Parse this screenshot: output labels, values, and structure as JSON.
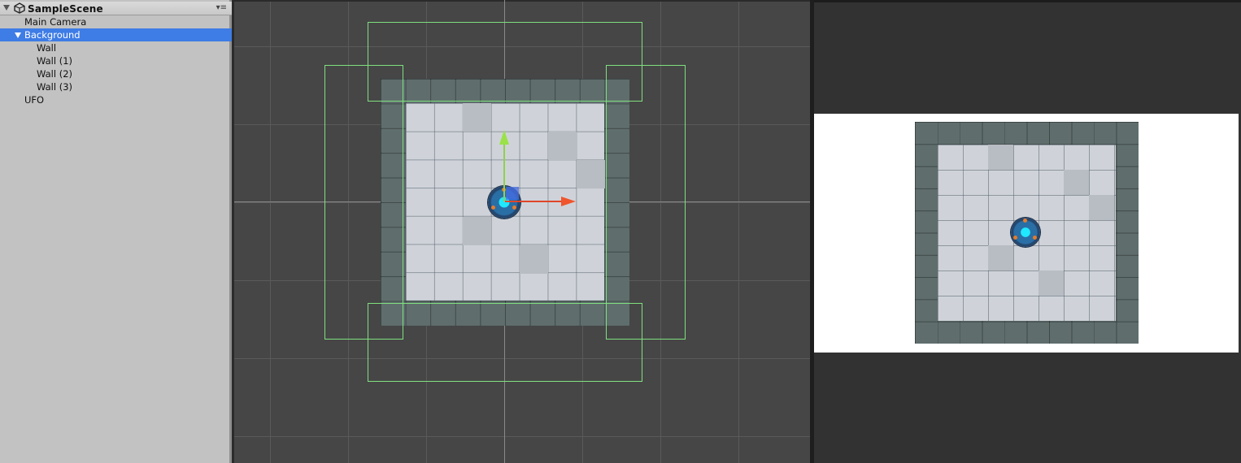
{
  "hierarchy": {
    "scene_name": "SampleScene",
    "menu_icon": "▾≡",
    "items": [
      {
        "label": "Main Camera",
        "depth": 1,
        "selected": false
      },
      {
        "label": "Background",
        "depth": 1,
        "selected": true,
        "expanded": true
      },
      {
        "label": "Wall",
        "depth": 2,
        "selected": false
      },
      {
        "label": "Wall (1)",
        "depth": 2,
        "selected": false
      },
      {
        "label": "Wall (2)",
        "depth": 2,
        "selected": false
      },
      {
        "label": "Wall (3)",
        "depth": 2,
        "selected": false
      },
      {
        "label": "UFO",
        "depth": 1,
        "selected": false
      }
    ]
  },
  "colors": {
    "selection": "#3e7ce6",
    "collider": "#7fe07f",
    "gizmo_x": "#f0552d",
    "gizmo_y": "#9ae248",
    "ufo_core": "#20e8ff"
  },
  "icons": [
    "unity-scene-icon",
    "context-menu-icon",
    "move-gizmo-icon",
    "ufo-sprite"
  ]
}
